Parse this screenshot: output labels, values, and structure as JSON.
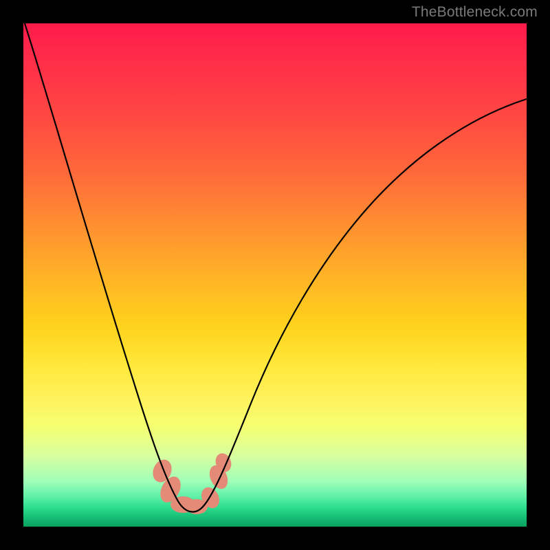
{
  "watermark": "TheBottleneck.com",
  "chart_data": {
    "type": "line",
    "title": "",
    "xlabel": "",
    "ylabel": "",
    "xlim": [
      0,
      100
    ],
    "ylim": [
      0,
      100
    ],
    "series": [
      {
        "name": "curve",
        "x": [
          0,
          4,
          8,
          12,
          16,
          20,
          23,
          25,
          27,
          29,
          31,
          33,
          35,
          37,
          39,
          42,
          46,
          52,
          60,
          70,
          82,
          100
        ],
        "values": [
          100,
          88,
          76,
          64,
          52,
          40,
          30,
          22,
          15,
          9,
          5,
          3,
          3,
          4,
          7,
          13,
          22,
          34,
          48,
          60,
          70,
          80
        ]
      }
    ],
    "color_scale_note": "background vertical gradient: red (top, high y) → orange → yellow → green (bottom, low y)",
    "highlight_region": {
      "description": "fat salmon-colored stroke near curve minimum",
      "x_range": [
        27,
        37
      ],
      "y_range": [
        2,
        11
      ]
    }
  }
}
